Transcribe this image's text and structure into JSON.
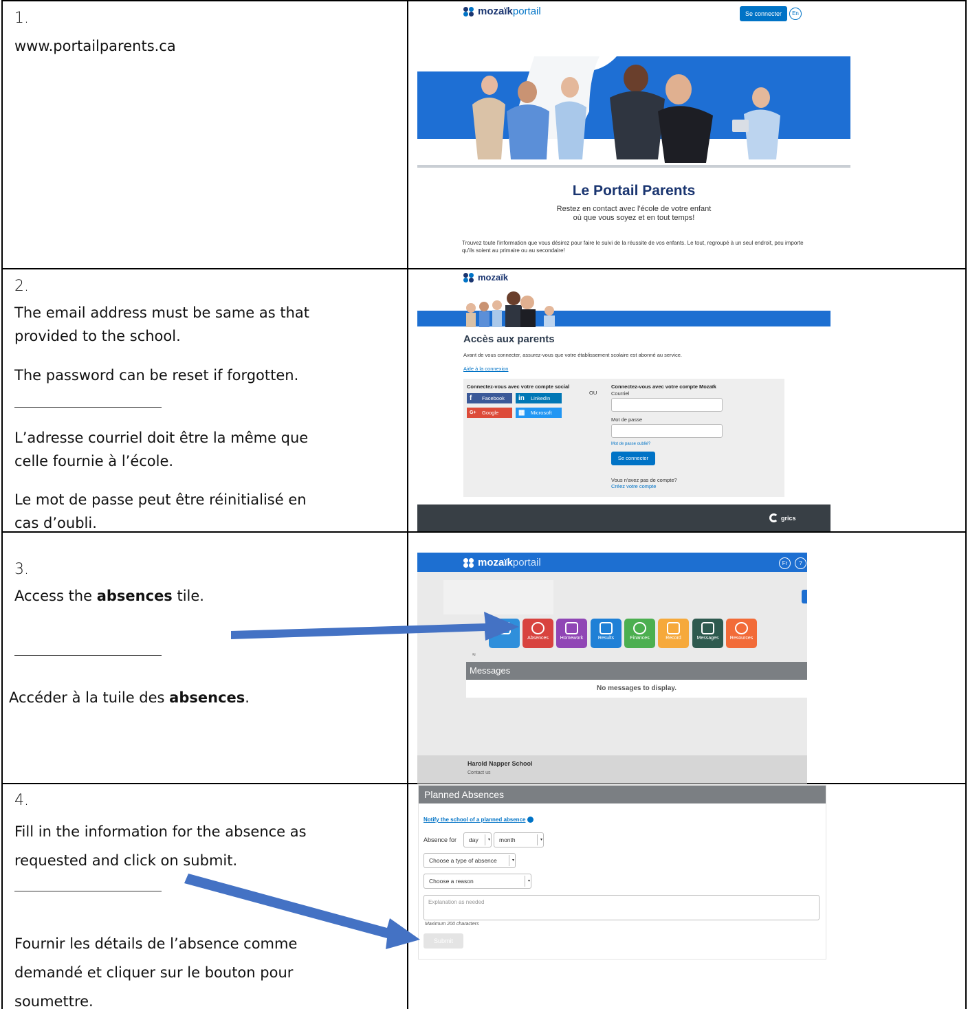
{
  "steps": [
    {
      "number": "1.",
      "lines": [
        "www.portailparents.ca"
      ]
    },
    {
      "number": "2.",
      "en": [
        "The email address must be same as that",
        "provided to the school.",
        "The password can be reset if forgotten."
      ],
      "fr": [
        "L’adresse courriel doit être la même que",
        "celle fournie à l’école.",
        "Le mot de passe peut être réinitialisé en",
        "cas d’oubli."
      ]
    },
    {
      "number": "3.",
      "en_pre": "Access the ",
      "en_bold": "absences",
      "en_post": " tile.",
      "fr_pre": "Accéder à la tuile des ",
      "fr_bold": "absences",
      "fr_post": "."
    },
    {
      "number": "4.",
      "en": [
        "Fill in the information for the absence as",
        "requested and click on submit."
      ],
      "fr": [
        "Fournir les détails de l’absence comme",
        "demandé et cliquer sur le bouton pour",
        "soumettre."
      ]
    }
  ],
  "shot1": {
    "logo_bold": "mozaïk",
    "logo_light": "portail",
    "login_button": "Se connecter",
    "lang": "En",
    "title": "Le Portail Parents",
    "subtitle_1": "Restez en contact avec l'école de votre enfant",
    "subtitle_2": "où que vous soyez et en tout temps!",
    "paragraph": "Trouvez toute l'information que vous désirez pour faire le suivi de la réussite de vos enfants. Le tout, regroupé à un seul endroit, peu importe qu'ils soient au primaire ou au secondaire!"
  },
  "shot2": {
    "logo": "mozaïk",
    "title": "Accès aux parents",
    "intro": "Avant de vous connecter, assurez-vous que votre établissement scolaire est abonné au service.",
    "help_link": "Aide à la connexion",
    "social_title": "Connectez-vous avec votre compte social",
    "social": [
      {
        "label": "Facebook",
        "icon": "f",
        "color": "#3b5998"
      },
      {
        "label": "LinkedIn",
        "icon": "in",
        "color": "#0077b5"
      },
      {
        "label": "Google",
        "icon": "G+",
        "color": "#dd4b39"
      },
      {
        "label": "Microsoft",
        "icon": "▦",
        "color": "#2196f3"
      }
    ],
    "or": "OU",
    "mozaik_title": "Connectez-vous avec votre compte Mozaïk",
    "email_label": "Courriel",
    "password_label": "Mot de passe",
    "forgot": "Mot de passe oublié?",
    "login_button": "Se connecter",
    "no_account": "Vous n'avez pas de compte?",
    "create_account": "Créez votre compte",
    "footer_brand": "grics"
  },
  "shot3": {
    "logo_bold": "mozaïk",
    "logo_light": "portail",
    "lang": "Fr",
    "help": "?",
    "tiles": [
      {
        "label": "",
        "color": "#2f8fdb",
        "icon": "calendar-icon"
      },
      {
        "label": "Absences",
        "color": "#d8433f",
        "icon": "absence-icon"
      },
      {
        "label": "Homework",
        "color": "#9046b5",
        "icon": "homework-icon"
      },
      {
        "label": "Results",
        "color": "#1f80d6",
        "icon": "results-icon"
      },
      {
        "label": "Finances",
        "color": "#4caf50",
        "icon": "finances-icon"
      },
      {
        "label": "Record",
        "color": "#f6a93b",
        "icon": "record-icon"
      },
      {
        "label": "Messages",
        "color": "#2e5a4f",
        "icon": "messages-icon"
      },
      {
        "label": "Resources",
        "color": "#f26b38",
        "icon": "resources-icon"
      }
    ],
    "collapse": "≈",
    "messages_header": "Messages",
    "no_messages": "No messages to display.",
    "school": "Harold Napper School",
    "contact": "Contact us"
  },
  "shot4": {
    "header": "Planned Absences",
    "notify_link": "Notify the school of a planned absence",
    "absence_for": "Absence for",
    "day": "day",
    "month": "month",
    "type_placeholder": "Choose a type of absence",
    "reason_placeholder": "Choose a reason",
    "explanation_placeholder": "Explanation as needed",
    "max_chars": "Maximum 200 characters",
    "submit": "Submit"
  },
  "colors": {
    "mozaik_blue": "#0073c6",
    "arrow": "#4472c4"
  }
}
